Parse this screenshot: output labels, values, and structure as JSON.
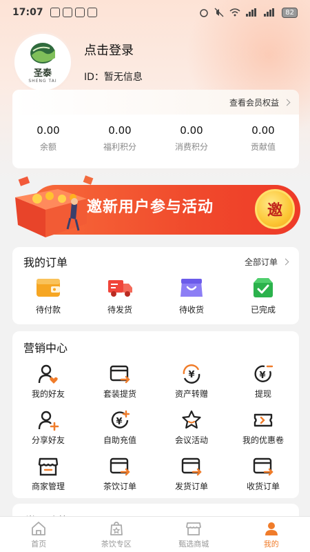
{
  "status_bar": {
    "time": "17:07",
    "battery": "82"
  },
  "profile": {
    "logo_cn": "圣泰",
    "logo_en": "SHENG TAI",
    "login_text": "点击登录",
    "id_text": "ID：暂无信息"
  },
  "assets": {
    "member_link": "查看会员权益",
    "items": [
      {
        "value": "0.00",
        "label": "余额"
      },
      {
        "value": "0.00",
        "label": "福利积分"
      },
      {
        "value": "0.00",
        "label": "消费积分"
      },
      {
        "value": "0.00",
        "label": "贡献值"
      }
    ]
  },
  "banner": {
    "text": "邀新用户参与活动",
    "badge": "邀"
  },
  "orders": {
    "title": "我的订单",
    "all_link": "全部订单",
    "items": [
      {
        "label": "待付款",
        "icon": "wallet-icon",
        "color": "#f6a623"
      },
      {
        "label": "待发货",
        "icon": "truck-icon",
        "color": "#f0453a"
      },
      {
        "label": "待收货",
        "icon": "box-icon",
        "color": "#7b6cf0"
      },
      {
        "label": "已完成",
        "icon": "check-box-icon",
        "color": "#2bb24c"
      }
    ]
  },
  "market": {
    "title": "营销中心",
    "items": [
      {
        "label": "我的好友",
        "icon": "friend-heart-icon"
      },
      {
        "label": "套装提货",
        "icon": "card-arrow-icon"
      },
      {
        "label": "资产转赠",
        "icon": "yen-transfer-icon"
      },
      {
        "label": "提现",
        "icon": "yen-withdraw-icon"
      },
      {
        "label": "分享好友",
        "icon": "friend-add-icon"
      },
      {
        "label": "自助充值",
        "icon": "yen-recharge-icon"
      },
      {
        "label": "会议活动",
        "icon": "star-icon"
      },
      {
        "label": "我的优惠卷",
        "icon": "coupon-icon"
      },
      {
        "label": "商家管理",
        "icon": "shop-icon"
      },
      {
        "label": "茶饮订单",
        "icon": "card-arrow-icon"
      },
      {
        "label": "发货订单",
        "icon": "card-arrow-icon"
      },
      {
        "label": "收货订单",
        "icon": "card-arrow-icon"
      }
    ]
  },
  "common": {
    "title": "常用功能"
  },
  "tabs": [
    {
      "label": "首页",
      "icon": "home-icon",
      "active": false
    },
    {
      "label": "茶饮专区",
      "icon": "tea-bag-icon",
      "active": false
    },
    {
      "label": "甄选商城",
      "icon": "store-icon",
      "active": false
    },
    {
      "label": "我的",
      "icon": "person-icon",
      "active": true
    }
  ],
  "colors": {
    "accent": "#f07c2a",
    "banner_red": "#f04a2c",
    "badge_yellow": "#fcc736"
  }
}
